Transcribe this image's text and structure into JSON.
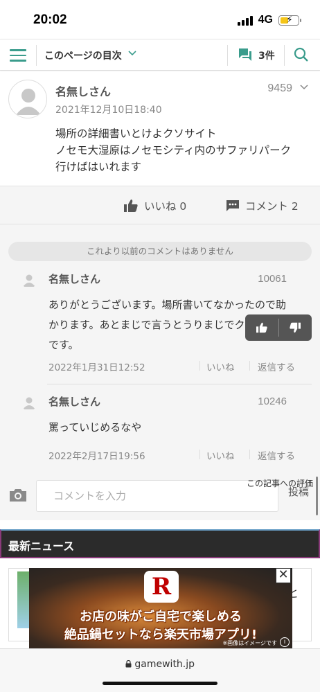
{
  "status_bar": {
    "time": "20:02",
    "network": "4G"
  },
  "toolbar": {
    "toc_label": "このページの目次",
    "comment_count": "3件"
  },
  "post": {
    "author": "名無しさん",
    "number": "9459",
    "date": "2021年12月10日18:40",
    "body_lines": [
      "場所の詳細書いとけよクソサイト",
      "ノセモ大湿原はノセモシティ内のサファリパーク",
      "行けばはいれます"
    ],
    "like_label": "いいね 0",
    "comment_label": "コメント 2"
  },
  "no_older_comments": "これより以前のコメントはありません",
  "replies": [
    {
      "author": "名無しさん",
      "number": "10061",
      "body_lines": [
        "ありがとうございます。場所書いてなかったので助",
        "かります。あとまじで言うとうりまじでクソサイト",
        "です。"
      ],
      "date": "2022年1月31日12:52",
      "like_label": "いいね",
      "reply_label": "返信する"
    },
    {
      "author": "名無しさん",
      "number": "10246",
      "body_lines": [
        "罵っていじめるなや"
      ],
      "date": "2022年2月17日19:56",
      "like_label": "いいね",
      "reply_label": "返信する"
    }
  ],
  "comment_input": {
    "placeholder": "コメントを入力",
    "vote_label": "この記事への評価",
    "post_label": "投稿"
  },
  "news": {
    "header": "最新ニュース",
    "first_title_fragment": "と"
  },
  "ad": {
    "logo_letter": "R",
    "line1": "お店の味がご自宅で楽しめる",
    "line2": "絶品鍋セットなら楽天市場アプリ!",
    "note": "※画像はイメージです",
    "close": "✕"
  },
  "browser": {
    "url": "gamewith.jp"
  },
  "colors": {
    "accent": "#3a9c8c",
    "news_header_bg": "#2b2b2b",
    "rakuten_red": "#bf0000"
  }
}
